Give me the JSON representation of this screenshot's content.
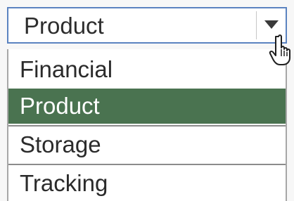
{
  "dropdown": {
    "selected_value": "Product",
    "arrow_icon": "chevron-down-icon",
    "options": [
      {
        "label": "Financial",
        "highlighted": false
      },
      {
        "label": "Product",
        "highlighted": true
      },
      {
        "label": "Storage",
        "highlighted": false
      },
      {
        "label": "Tracking",
        "highlighted": false
      }
    ]
  },
  "colors": {
    "focus_border": "#5b83c0",
    "highlight_background": "#4a7350",
    "highlight_text": "#ffffff"
  },
  "cursor_icon": "hand-pointer-icon"
}
